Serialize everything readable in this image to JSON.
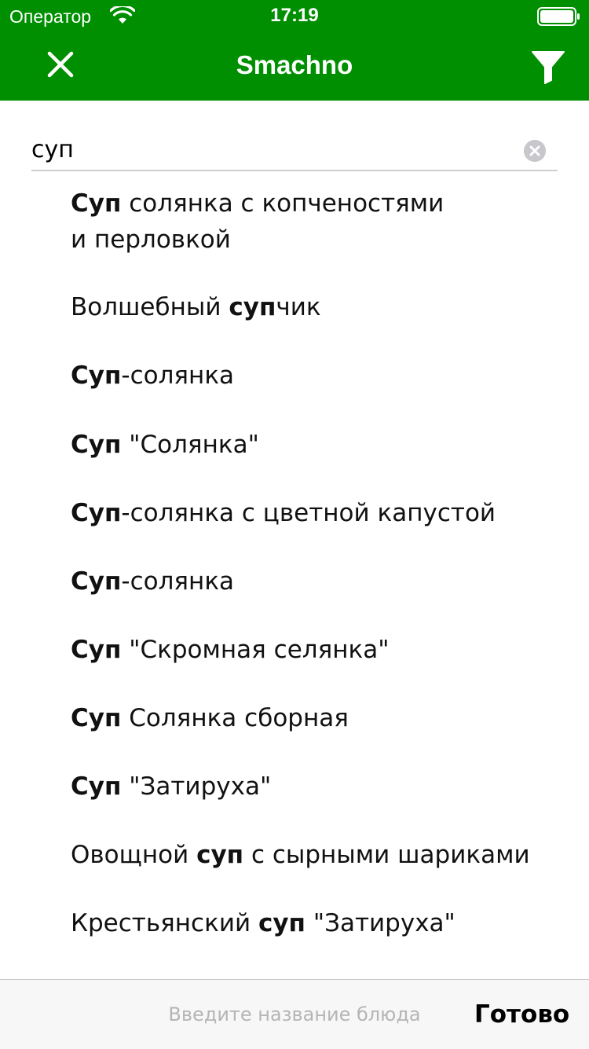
{
  "status_bar": {
    "carrier": "Оператор",
    "time": "17:19"
  },
  "nav": {
    "title": "Smachno",
    "close_icon": "close-icon",
    "filter_icon": "filter-icon"
  },
  "search": {
    "value": "суп",
    "clear_icon": "clear-icon"
  },
  "suggestions": [
    [
      {
        "t": "Суп",
        "b": true
      },
      {
        "t": " солянка с копченостями",
        "b": false
      },
      {
        "t": "\n",
        "b": false
      },
      {
        "t": "и перловкой",
        "b": false
      }
    ],
    [
      {
        "t": "Волшебный ",
        "b": false
      },
      {
        "t": "суп",
        "b": true
      },
      {
        "t": "чик",
        "b": false
      }
    ],
    [
      {
        "t": "Суп",
        "b": true
      },
      {
        "t": "-солянка",
        "b": false
      }
    ],
    [
      {
        "t": "Суп",
        "b": true
      },
      {
        "t": " \"Солянка\"",
        "b": false
      }
    ],
    [
      {
        "t": "Суп",
        "b": true
      },
      {
        "t": "-солянка с цветной капустой",
        "b": false
      }
    ],
    [
      {
        "t": "Суп",
        "b": true
      },
      {
        "t": "-солянка",
        "b": false
      }
    ],
    [
      {
        "t": "Суп",
        "b": true
      },
      {
        "t": " \"Скромная селянка\"",
        "b": false
      }
    ],
    [
      {
        "t": "Суп",
        "b": true
      },
      {
        "t": " Солянка сборная",
        "b": false
      }
    ],
    [
      {
        "t": "Суп",
        "b": true
      },
      {
        "t": " \"Затируха\"",
        "b": false
      }
    ],
    [
      {
        "t": "Овощной ",
        "b": false
      },
      {
        "t": "суп",
        "b": true
      },
      {
        "t": " с сырными шариками",
        "b": false
      }
    ],
    [
      {
        "t": "Крестьянский ",
        "b": false
      },
      {
        "t": "суп",
        "b": true
      },
      {
        "t": " \"Затируха\"",
        "b": false
      }
    ]
  ],
  "bottom_bar": {
    "placeholder": "Введите название блюда",
    "done_label": "Готово"
  },
  "colors": {
    "brand_green": "#008f00",
    "background": "#ffffff",
    "separator": "#cfcfcf"
  }
}
